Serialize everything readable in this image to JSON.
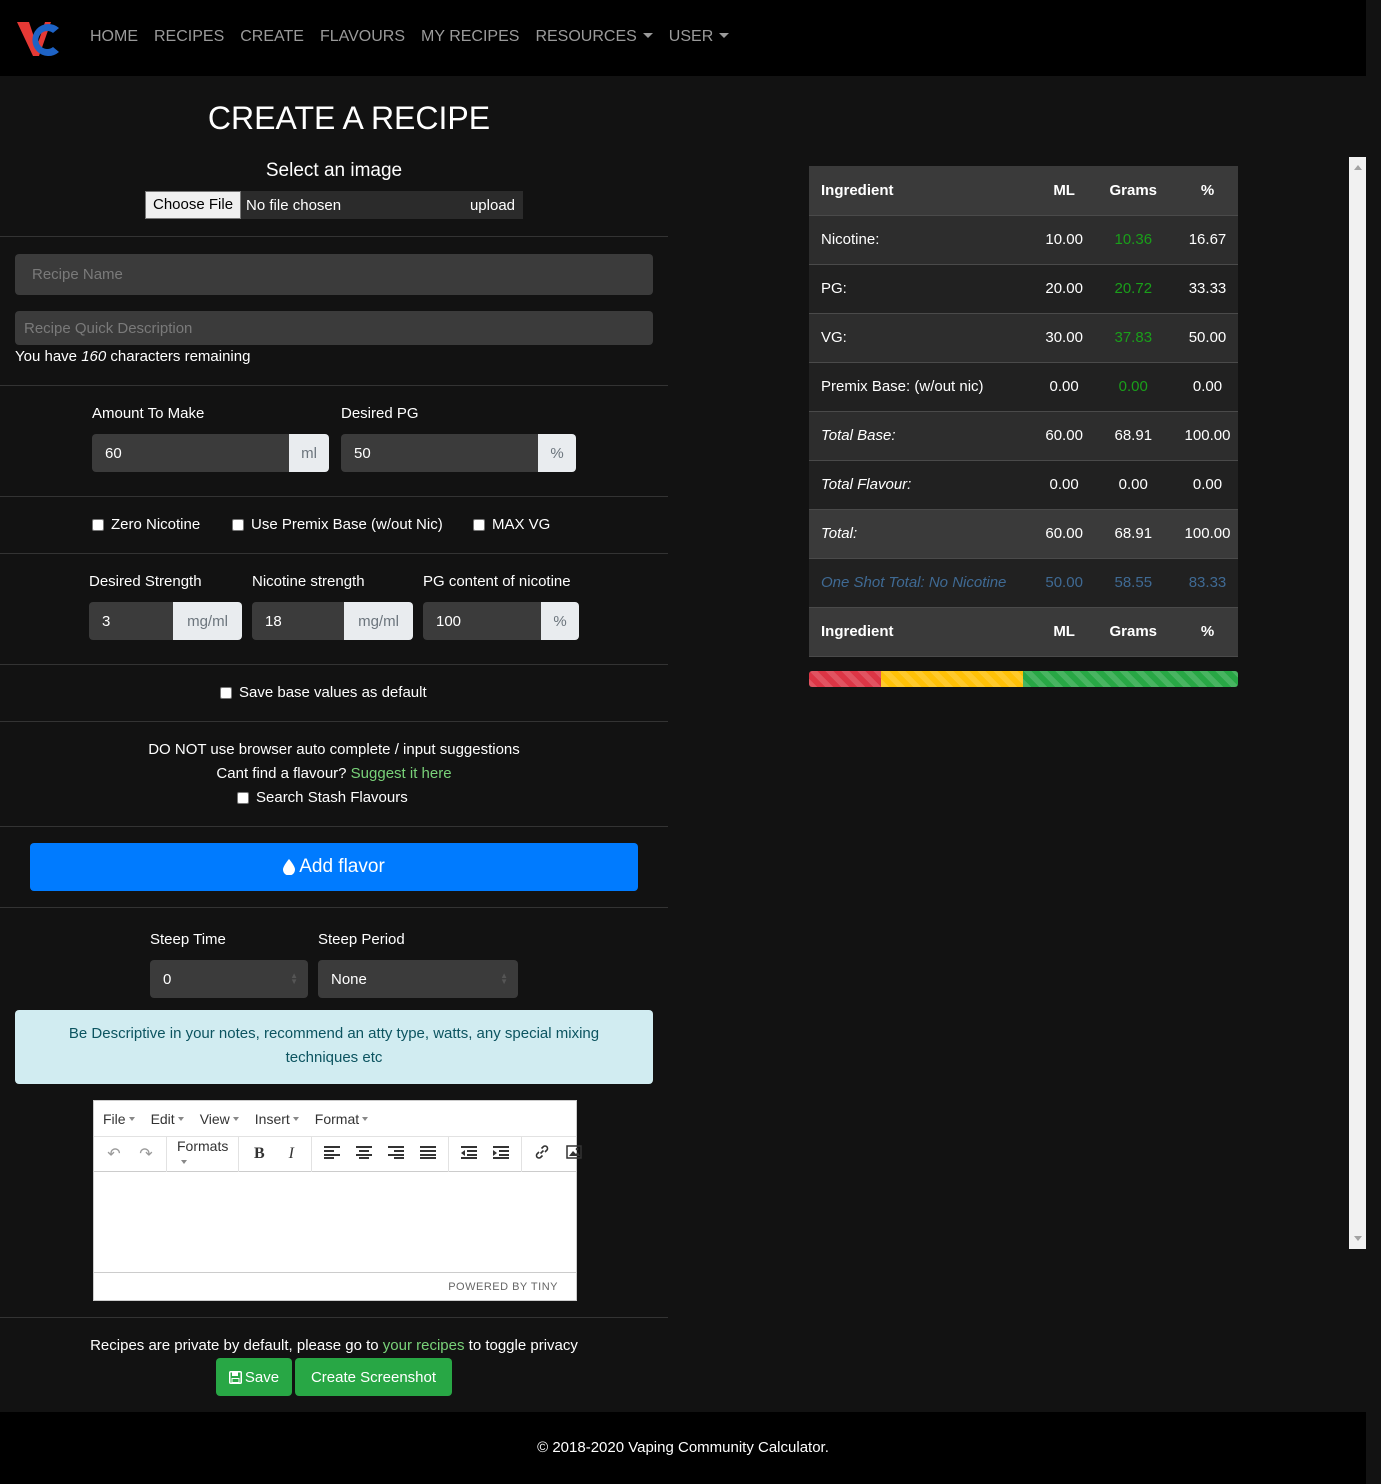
{
  "nav": {
    "items": [
      {
        "label": "HOME",
        "dropdown": false
      },
      {
        "label": "RECIPES",
        "dropdown": false
      },
      {
        "label": "CREATE",
        "dropdown": false
      },
      {
        "label": "FLAVOURS",
        "dropdown": false
      },
      {
        "label": "MY RECIPES",
        "dropdown": false
      },
      {
        "label": "RESOURCES",
        "dropdown": true
      },
      {
        "label": "USER",
        "dropdown": true
      }
    ]
  },
  "form": {
    "title": "CREATE A RECIPE",
    "image_label": "Select an image",
    "file_button": "Choose File",
    "file_status": "No file chosen",
    "upload_label": "upload",
    "recipe_name_placeholder": "Recipe Name",
    "description_placeholder": "Recipe Quick Description",
    "chars_prefix": "You have",
    "chars_count": "160",
    "chars_suffix": "characters remaining",
    "amount_label": "Amount To Make",
    "amount_value": "60",
    "amount_unit": "ml",
    "pg_label": "Desired PG",
    "pg_value": "50",
    "pg_unit": "%",
    "cb_zero_nic": "Zero Nicotine",
    "cb_premix": "Use Premix Base (w/out Nic)",
    "cb_maxvg": "MAX VG",
    "strength_label": "Desired Strength",
    "strength_value": "3",
    "strength_unit": "mg/ml",
    "nic_strength_label": "Nicotine strength",
    "nic_strength_value": "18",
    "nic_strength_unit": "mg/ml",
    "nic_pg_label": "PG content of nicotine",
    "nic_pg_value": "100",
    "nic_pg_unit": "%",
    "cb_save_default": "Save base values as default",
    "autocomplete_warning": "DO NOT use browser auto complete / input suggestions",
    "cant_find": "Cant find a flavour?",
    "suggest_link": "Suggest it here",
    "cb_stash": "Search Stash Flavours",
    "add_flavor": "Add flavor",
    "steep_time_label": "Steep Time",
    "steep_time_value": "0",
    "steep_period_label": "Steep Period",
    "steep_period_value": "None",
    "notes_hint": "Be Descriptive in your notes, recommend an atty type, watts, any special mixing techniques etc",
    "privacy_prefix": "Recipes are private by default, please go to",
    "privacy_link": "your recipes",
    "privacy_suffix": "to toggle privacy",
    "save_label": "Save",
    "screenshot_label": "Create Screenshot"
  },
  "editor": {
    "menu": [
      "File",
      "Edit",
      "View",
      "Insert",
      "Format"
    ],
    "formats_label": "Formats",
    "powered_by": "POWERED BY TINY"
  },
  "table": {
    "headers": [
      "Ingredient",
      "ML",
      "Grams",
      "%"
    ],
    "rows": [
      {
        "name": "Nicotine:",
        "ml": "10.00",
        "grams": "10.36",
        "pct": "16.67"
      },
      {
        "name": "PG:",
        "ml": "20.00",
        "grams": "20.72",
        "pct": "33.33"
      },
      {
        "name": "VG:",
        "ml": "30.00",
        "grams": "37.83",
        "pct": "50.00"
      },
      {
        "name": "Premix Base: (w/out nic)",
        "ml": "0.00",
        "grams": "0.00",
        "pct": "0.00"
      },
      {
        "name": "Total Base:",
        "ml": "60.00",
        "grams": "68.91",
        "pct": "100.00"
      },
      {
        "name": "Total Flavour:",
        "ml": "0.00",
        "grams": "0.00",
        "pct": "0.00"
      },
      {
        "name": "Total:",
        "ml": "60.00",
        "grams": "68.91",
        "pct": "100.00"
      },
      {
        "name": "One Shot Total: No Nicotine",
        "ml": "50.00",
        "grams": "58.55",
        "pct": "83.33"
      }
    ]
  },
  "progress": {
    "segments": [
      {
        "color": "#dc3545",
        "percent": 16.67
      },
      {
        "color": "#ffc107",
        "percent": 33.33
      },
      {
        "color": "#28a745",
        "percent": 50.0
      }
    ]
  },
  "footer": {
    "text": "© 2018-2020 Vaping Community Calculator."
  }
}
